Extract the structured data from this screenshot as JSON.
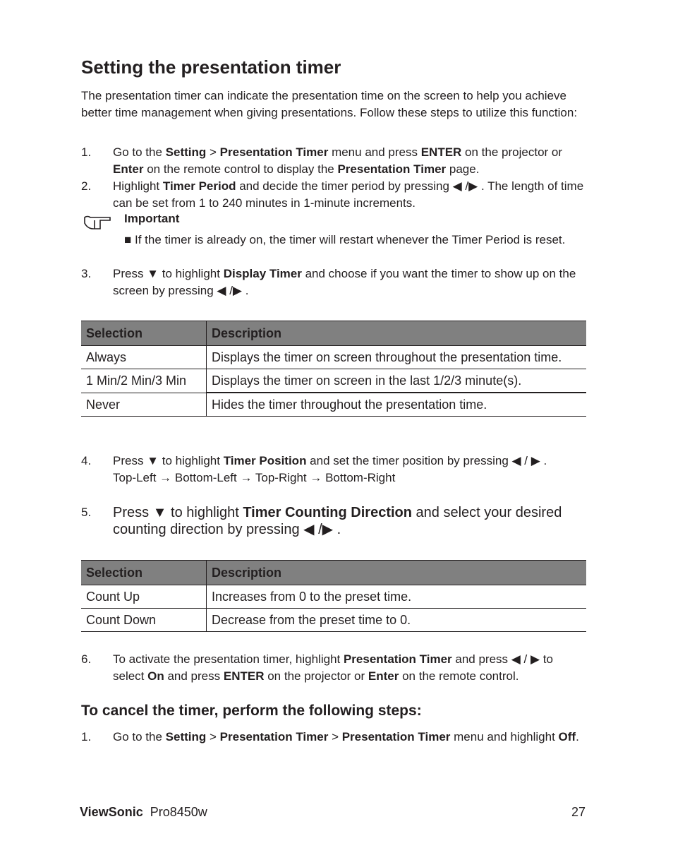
{
  "title": "Setting the presentation timer",
  "intro": "The presentation timer can indicate the presentation time on the screen to help you achieve better time management when giving presentations. Follow these steps to utilize this function:",
  "steps": {
    "s1": {
      "num": "1.",
      "parts": [
        "Go to the ",
        "Setting",
        " > ",
        "Presentation Timer",
        " menu and press ",
        "ENTER",
        " on the projector or ",
        "Enter",
        " on the remote control to display the ",
        "Presentation Timer",
        " page."
      ]
    },
    "s2": {
      "num": "2.",
      "parts": [
        "Highlight ",
        "Timer Period",
        " and decide the timer period by pressing ◀ /▶ . The length of time can be set from 1 to 240 minutes in 1-minute increments."
      ]
    },
    "s3": {
      "num": "3.",
      "parts": [
        "Press ▼ to highlight ",
        "Display Timer",
        " and choose if you want the timer to show up on the screen by pressing ◀ /▶ ."
      ]
    },
    "s4": {
      "num": "4.",
      "parts": [
        "Press ▼ to highlight ",
        "Timer Position",
        " and set the timer position by pressing ◀ / ▶ ."
      ],
      "sub": "Top-Left → Bottom-Left → Top-Right → Bottom-Right"
    },
    "s5": {
      "num": "5.",
      "parts": [
        "Press ▼ to highlight ",
        "Timer Counting Direction",
        " and select your desired counting direction by pressing ◀ /▶ ."
      ]
    },
    "s6": {
      "num": "6.",
      "parts": [
        "To activate the presentation timer, highlight ",
        "Presentation Timer",
        " and press ◀ / ▶ to select ",
        "On",
        " and press ",
        "ENTER",
        " on the projector or ",
        "Enter",
        " on the remote control."
      ]
    }
  },
  "important": {
    "label": "Important",
    "text": "If the timer is already on, the timer will restart whenever the Timer Period is reset."
  },
  "table1": {
    "headers": [
      "Selection",
      "Description"
    ],
    "rows": [
      [
        "Always",
        "Displays the timer on screen throughout the presentation time."
      ],
      [
        "1 Min/2 Min/3 Min",
        "Displays the timer on screen in the last 1/2/3 minute(s)."
      ],
      [
        "Never",
        "Hides the timer throughout the presentation time."
      ]
    ]
  },
  "table2": {
    "headers": [
      "Selection",
      "Description"
    ],
    "rows": [
      [
        "Count Up",
        "Increases from 0 to the preset time."
      ],
      [
        "Count Down",
        "Decrease from the preset time to 0."
      ]
    ]
  },
  "cancel": {
    "heading": "To cancel the timer, perform the following steps:",
    "num": "1.",
    "parts": [
      "Go to the ",
      "Setting",
      " > ",
      "Presentation Timer",
      " > ",
      "Presentation Timer",
      " menu and highlight ",
      "Off",
      "."
    ]
  },
  "footer": {
    "brand": "ViewSonic",
    "model": "Pro8450w",
    "page": "27"
  }
}
